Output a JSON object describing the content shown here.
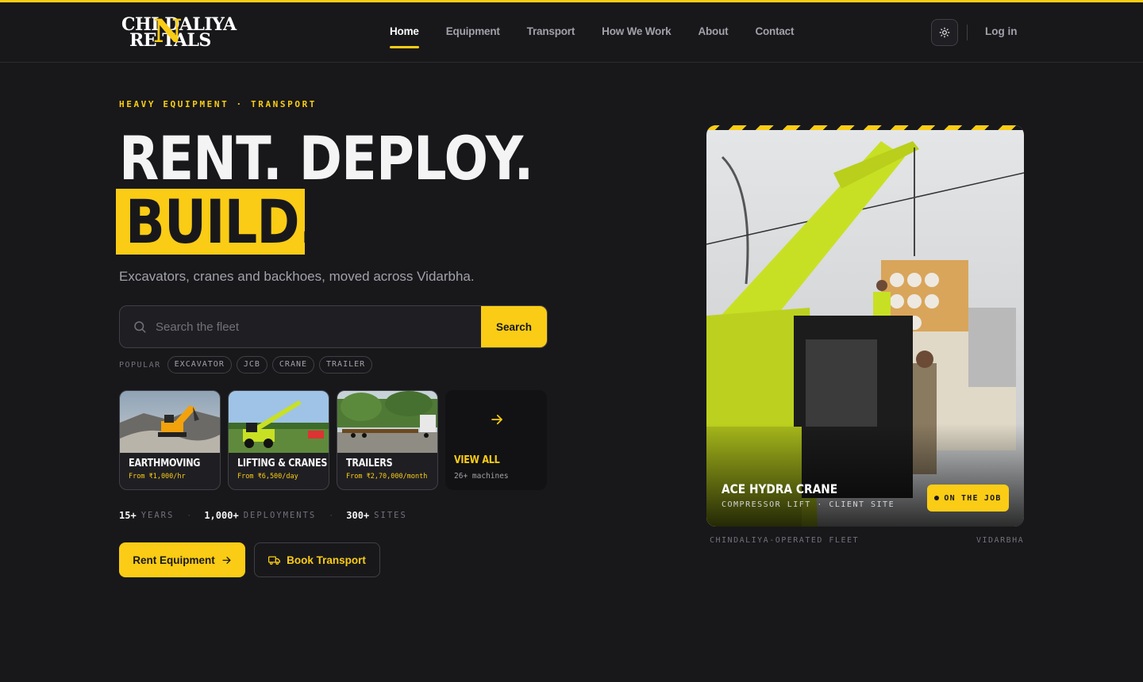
{
  "brand": {
    "logo_line1": "CHI DALIYA",
    "logo_line2": "RE TALS",
    "logo_n": "N",
    "accent": "#facc15"
  },
  "nav": {
    "items": [
      {
        "label": "Home",
        "active": true
      },
      {
        "label": "Equipment"
      },
      {
        "label": "Transport"
      },
      {
        "label": "How We Work"
      },
      {
        "label": "About"
      },
      {
        "label": "Contact"
      }
    ],
    "theme_icon": "sun-icon",
    "login": "Log in"
  },
  "hero": {
    "eyebrow": "HEAVY EQUIPMENT · TRANSPORT",
    "line1": "RENT. DEPLOY.",
    "line2": "BUILD.",
    "subtitle": "Excavators, cranes and backhoes, moved across Vidarbha."
  },
  "search": {
    "placeholder": "Search the fleet",
    "button": "Search",
    "icon": "search-icon"
  },
  "popular": {
    "label": "POPULAR",
    "tags": [
      "EXCAVATOR",
      "JCB",
      "CRANE",
      "TRAILER"
    ]
  },
  "categories": [
    {
      "title": "EARTHMOVING",
      "price": "From ₹1,000/hr"
    },
    {
      "title": "LIFTING & CRANES",
      "price": "From ₹6,500/day"
    },
    {
      "title": "TRAILERS",
      "price": "From ₹2,70,000/month"
    }
  ],
  "view_all": {
    "title": "VIEW ALL",
    "count": "26+ machines",
    "icon": "arrow-right-icon"
  },
  "stats": [
    {
      "value": "15+",
      "unit": "YEARS"
    },
    {
      "value": "1,000+",
      "unit": "DEPLOYMENTS"
    },
    {
      "value": "300+",
      "unit": "SITES"
    }
  ],
  "cta": {
    "rent": "Rent Equipment",
    "transport": "Book Transport"
  },
  "feature": {
    "title": "ACE HYDRA CRANE",
    "subtitle": "COMPRESSOR LIFT · CLIENT SITE",
    "status": "ON THE JOB",
    "caption_left": "CHINDALIYA-OPERATED FLEET",
    "caption_right": "VIDARBHA"
  }
}
